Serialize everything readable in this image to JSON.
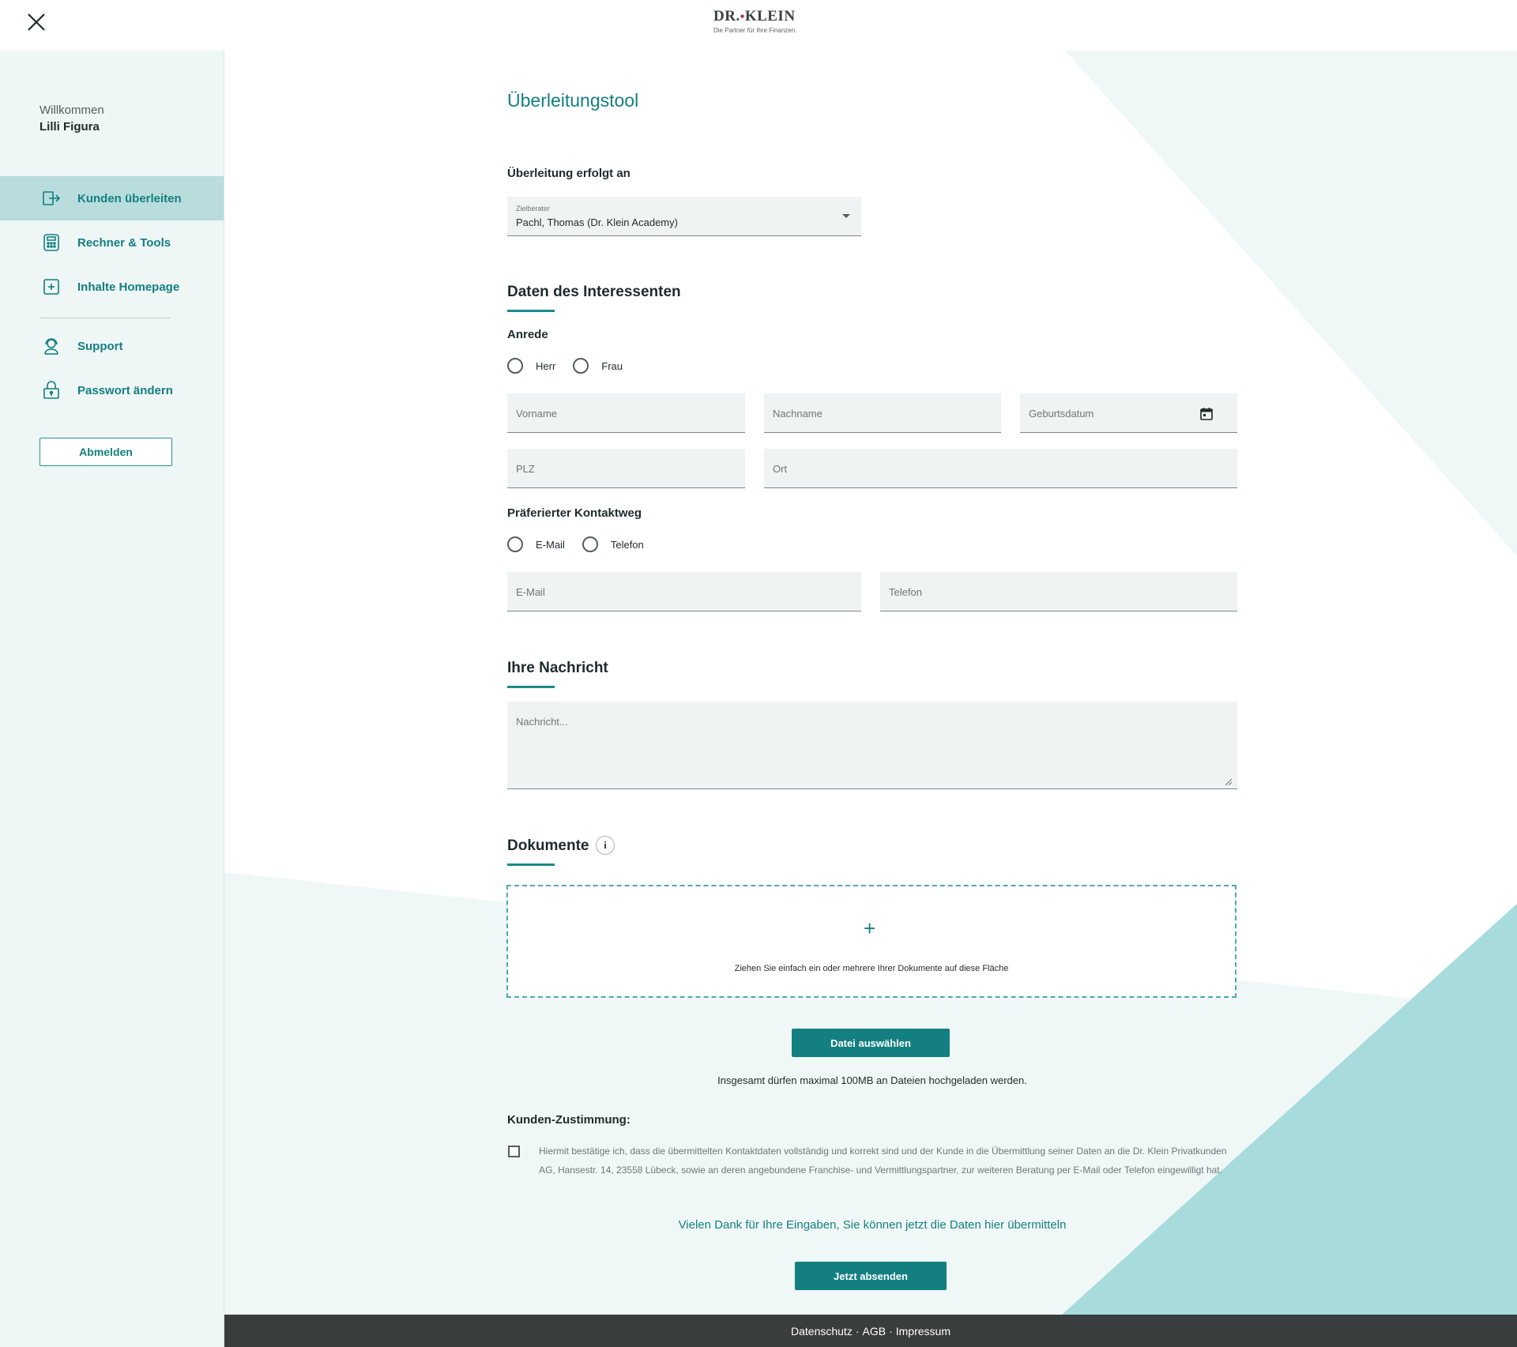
{
  "header": {
    "logo_main": "DR.",
    "logo_main_2": "KLEIN",
    "logo_tagline": "Die Partner für Ihre Finanzen."
  },
  "sidebar": {
    "welcome": "Willkommen",
    "username": "Lilli Figura",
    "items": [
      {
        "label": "Kunden überleiten",
        "icon": "exit-arrow-icon",
        "active": true
      },
      {
        "label": "Rechner & Tools",
        "icon": "calculator-icon",
        "active": false
      },
      {
        "label": "Inhalte Homepage",
        "icon": "plus-square-icon",
        "active": false
      },
      {
        "label": "Support",
        "icon": "headset-icon",
        "active": false
      },
      {
        "label": "Passwort ändern",
        "icon": "lock-icon",
        "active": false
      }
    ],
    "logout_label": "Abmelden"
  },
  "main": {
    "title": "Überleitungstool",
    "transfer_label": "Überleitung erfolgt an",
    "select": {
      "small_label": "Zielberater",
      "value": "Pachl, Thomas (Dr. Klein Academy)"
    },
    "interessent_title": "Daten des Interessenten",
    "anrede_label": "Anrede",
    "anrede_options": [
      "Herr",
      "Frau"
    ],
    "fields": {
      "vorname": "Vorname",
      "nachname": "Nachname",
      "geburtsdatum": "Geburtsdatum",
      "plz": "PLZ",
      "ort": "Ort",
      "email": "E-Mail",
      "telefon": "Telefon"
    },
    "kontakt_label": "Präferierter Kontaktweg",
    "kontakt_options": [
      "E-Mail",
      "Telefon"
    ],
    "nachricht_title": "Ihre Nachricht",
    "nachricht_placeholder": "Nachricht...",
    "dokumente_title": "Dokumente",
    "info_glyph": "i",
    "dropzone_plus": "+",
    "dropzone_text": "Ziehen Sie einfach ein oder mehrere Ihrer Dokumente auf diese Fläche",
    "file_button": "Datei auswählen",
    "upload_note": "Insgesamt dürfen maximal 100MB an Dateien hochgeladen werden.",
    "consent_label": "Kunden-Zustimmung:",
    "consent_text": "Hiermit bestätige ich, dass die übermittelten Kontaktdaten vollständig und korrekt sind und der Kunde in die Übermittlung seiner Daten an die Dr. Klein Privatkunden AG, Hansestr. 14, 23558 Lübeck, sowie an deren angebundene Franchise- und Vermittlungspartner, zur weiteren Beratung per E-Mail oder Telefon eingewilligt hat.",
    "thanks_text": "Vielen Dank für Ihre Eingaben, Sie können jetzt die Daten hier übermitteln",
    "submit_button": "Jetzt absenden"
  },
  "footer": {
    "links": [
      "Datenschutz",
      "AGB",
      "Impressum"
    ],
    "separator": "·"
  },
  "colors": {
    "accent": "#147f80",
    "active_nav": "#b9dcdc",
    "sidebar_bg": "#eef6f6",
    "field_bg": "#eff3f3",
    "footer_bg": "#3a3d3e",
    "deco_light": "#f0f8f7",
    "deco_teal": "#a8dcdc",
    "logo_dot": "#c0272d"
  }
}
